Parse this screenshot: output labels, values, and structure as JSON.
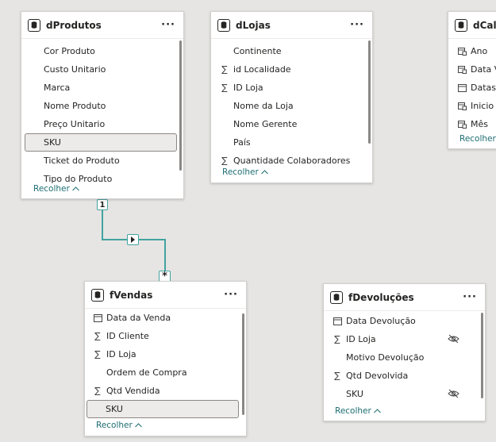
{
  "tables": {
    "dProdutos": {
      "title": "dProdutos",
      "fields": [
        "Cor Produto",
        "Custo Unitario",
        "Marca",
        "Nome Produto",
        "Preço Unitario",
        "SKU",
        "Ticket do Produto",
        "Tipo do Produto"
      ],
      "collapse": "Recolher"
    },
    "dLojas": {
      "title": "dLojas",
      "fields": [
        "Continente",
        "id Localidade",
        "ID Loja",
        "Nome da Loja",
        "Nome Gerente",
        "País",
        "Quantidade Colaboradores"
      ],
      "collapse": "Recolher"
    },
    "dCalendario": {
      "title": "dCale",
      "fields": [
        "Ano",
        "Data Vi",
        "Datas",
        "Inicio d",
        "Mês"
      ],
      "collapse": "Recolher"
    },
    "fVendas": {
      "title": "fVendas",
      "fields": [
        "Data da Venda",
        "ID Cliente",
        "ID Loja",
        "Ordem de Compra",
        "Qtd Vendida",
        "SKU"
      ],
      "collapse": "Recolher"
    },
    "fDevolucoes": {
      "title": "fDevoluções",
      "fields": [
        "Data Devolução",
        "ID Loja",
        "Motivo Devolução",
        "Qtd Devolvida",
        "SKU"
      ],
      "collapse": "Recolher"
    }
  },
  "relationship": {
    "one_side": "1",
    "many_side": "*",
    "direction_icon": "single-direction-arrow-icon"
  },
  "more_label": "···",
  "colors": {
    "canvas": "#e6e5e3",
    "relationship": "#43a3a0",
    "collapse_link": "#1e6e72"
  }
}
